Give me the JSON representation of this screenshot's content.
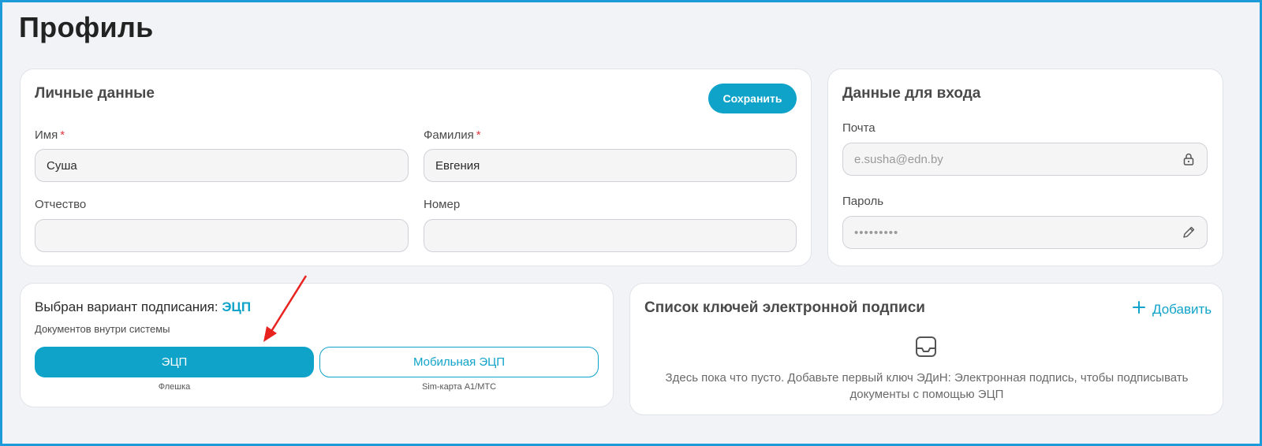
{
  "page": {
    "title": "Профиль"
  },
  "personal": {
    "title": "Личные данные",
    "save_label": "Сохранить",
    "first_name": {
      "label": "Имя",
      "required_mark": "*",
      "value": "Суша"
    },
    "last_name": {
      "label": "Фамилия",
      "required_mark": "*",
      "value": "Евгения"
    },
    "patronymic": {
      "label": "Отчество",
      "value": ""
    },
    "phone": {
      "label": "Номер",
      "value": ""
    }
  },
  "login": {
    "title": "Данные для входа",
    "email": {
      "label": "Почта",
      "value": "e.susha@edn.by",
      "icon": "lock-icon"
    },
    "password": {
      "label": "Пароль",
      "value": "•••••••••",
      "icon": "pencil-icon"
    }
  },
  "signing": {
    "title_prefix": "Выбран вариант подписания:",
    "title_value": "ЭЦП",
    "subtitle": "Документов внутри системы",
    "options": [
      {
        "label": "ЭЦП",
        "caption": "Флешка",
        "selected": true
      },
      {
        "label": "Мобильная ЭЦП",
        "caption": "Sim-карта A1/МТС",
        "selected": false
      }
    ]
  },
  "keys": {
    "title": "Список ключей электронной подписи",
    "add_label": "Добавить",
    "empty_icon": "inbox-icon",
    "empty_text": "Здесь пока что пусто. Добавьте первый ключ ЭДиН: Электронная подпись, чтобы подписывать документы с помощью ЭЦП"
  },
  "colors": {
    "accent": "#0fa3c9",
    "required": "#e0393e",
    "annotation_arrow": "#e8231f",
    "frame": "#1d9bd8"
  }
}
